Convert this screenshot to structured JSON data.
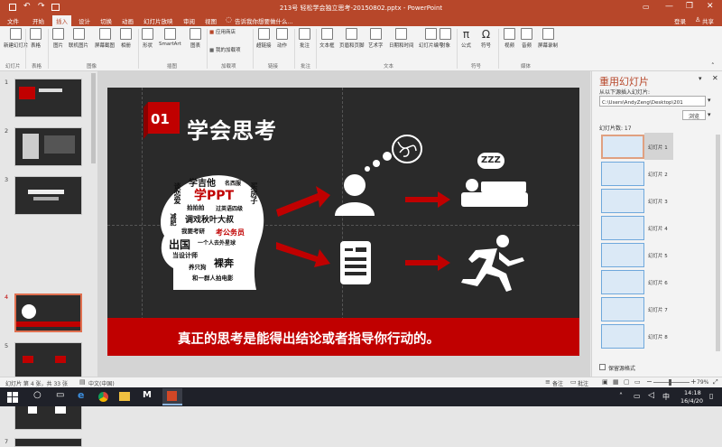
{
  "window": {
    "title": "213号 轻松学会独立思考-20150802.pptx - PowerPoint",
    "login": "登录",
    "share": "共享"
  },
  "tabs": [
    "文件",
    "开始",
    "插入",
    "设计",
    "切换",
    "动画",
    "幻灯片放映",
    "审阅",
    "视图"
  ],
  "active_tab": "插入",
  "tell_me": "告诉我你想要做什么...",
  "ribbon": {
    "buttons": [
      "新建幻灯片",
      "表格",
      "图片",
      "联机图片",
      "屏幕截图",
      "相册",
      "形状",
      "SmartArt",
      "图表",
      "应用商店",
      "我的加载项",
      "超链接",
      "动作",
      "批注",
      "文本框",
      "页眉和页脚",
      "艺术字",
      "日期和时间",
      "幻灯片编号",
      "对象",
      "公式",
      "符号",
      "视频",
      "音频",
      "屏幕录制"
    ],
    "groups": [
      "幻灯片",
      "表格",
      "图像",
      "插图",
      "加载项",
      "链接",
      "批注",
      "文本",
      "符号",
      "媒体"
    ]
  },
  "thumbnails": [
    {
      "num": "1"
    },
    {
      "num": "2"
    },
    {
      "num": "3"
    },
    {
      "num": "4"
    },
    {
      "num": "5"
    },
    {
      "num": "6"
    },
    {
      "num": "7"
    }
  ],
  "slide": {
    "number": "01",
    "heading": "学会思考",
    "words": [
      "学吉他",
      "学PPT",
      "谈恋爱",
      "买房子",
      "名西服",
      "拍拍拍",
      "过英语四级",
      "减肥",
      "调戏秋叶大叔",
      "我要考研",
      "考公务员",
      "出国",
      "一个人去外星球",
      "当设计师",
      "养只狗",
      "裸奔",
      "和一群人拍电影"
    ],
    "bubble": "ZZZ",
    "footer": "真正的思考是能得出结论或者指导你行动的。"
  },
  "reuse": {
    "title": "重用幻灯片",
    "insert_label": "从以下源插入幻灯片:",
    "path": "C:\\Users\\AndyZeng\\Desktop\\201",
    "browse": "浏览",
    "count_label": "幻灯片数: 17",
    "items": [
      "幻灯片 1",
      "幻灯片 2",
      "幻灯片 3",
      "幻灯片 4",
      "幻灯片 5",
      "幻灯片 6",
      "幻灯片 7",
      "幻灯片 8"
    ],
    "keep_format": "保留源格式"
  },
  "status": {
    "slide_info": "幻灯片 第 4 张，共 33 张",
    "lang": "中文(中国)",
    "notes": "备注",
    "comments": "批注",
    "zoom": "79%"
  },
  "clock": {
    "time": "14:18",
    "date": "16/4/20"
  },
  "colors": {
    "brand": "#b7472a",
    "accent": "#c00000",
    "slide_bg": "#2a2a2a"
  }
}
